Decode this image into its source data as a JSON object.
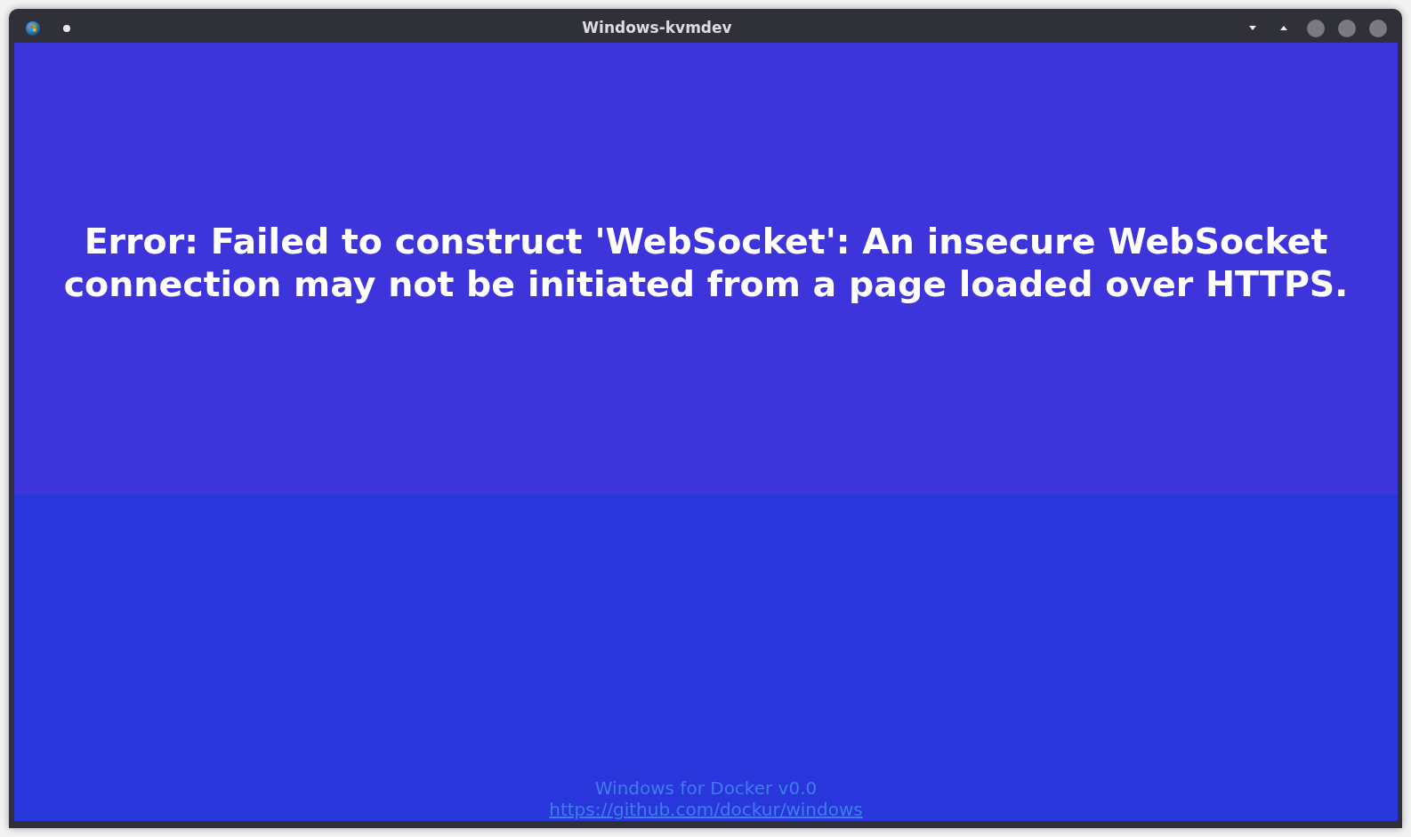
{
  "window": {
    "title": "Windows-kvmdev"
  },
  "error": {
    "message": "Error: Failed to construct 'WebSocket': An insecure WebSocket connection may not be initiated from a page loaded over HTTPS."
  },
  "footer": {
    "product": "Windows for Docker v0.0",
    "link": "https://github.com/dockur/windows"
  }
}
